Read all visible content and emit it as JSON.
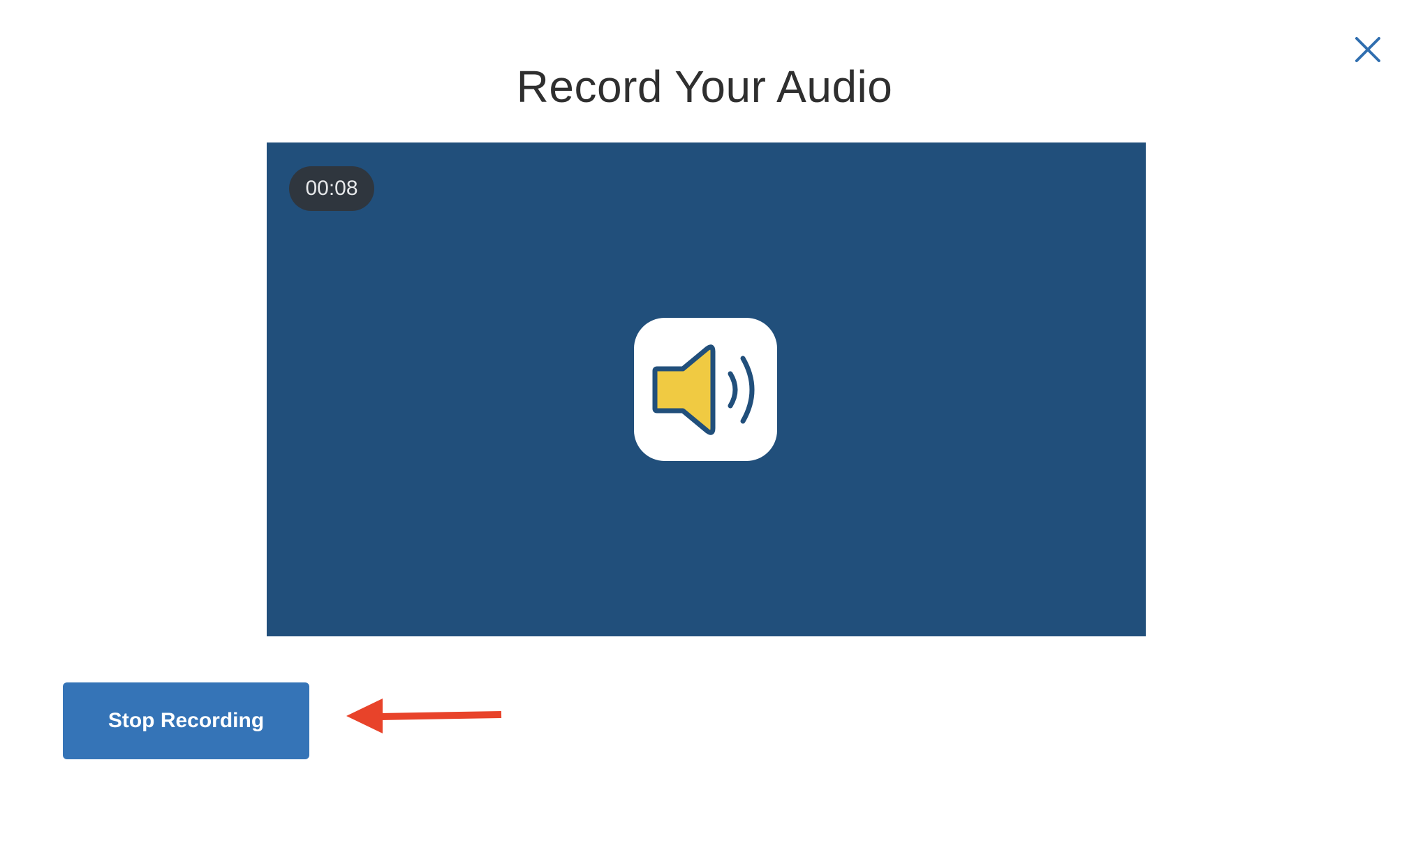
{
  "modal": {
    "title": "Record Your Audio",
    "close_icon": "close-icon"
  },
  "recorder": {
    "elapsed_time": "00:08",
    "icon": "speaker-volume-icon",
    "colors": {
      "stage_background": "#214f7b",
      "speaker_fill": "#f0ca42",
      "speaker_stroke": "#214f7b"
    }
  },
  "actions": {
    "stop_label": "Stop Recording",
    "stop_color": "#3574b7"
  },
  "annotation": {
    "icon": "red-arrow-icon",
    "color": "#e8432a"
  }
}
